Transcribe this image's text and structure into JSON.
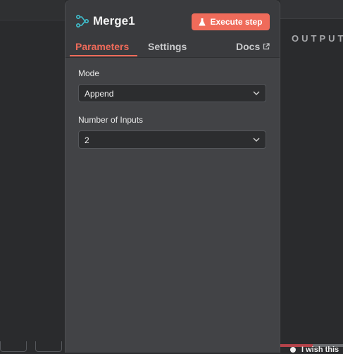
{
  "node": {
    "title": "Merge1",
    "execute_label": "Execute step"
  },
  "tabs": {
    "parameters": "Parameters",
    "settings": "Settings",
    "docs": "Docs"
  },
  "fields": {
    "mode_label": "Mode",
    "mode_value": "Append",
    "inputs_label": "Number of Inputs",
    "inputs_value": "2"
  },
  "output": {
    "label": "OUTPUT"
  },
  "footer": {
    "wish_text": "I wish this"
  },
  "colors": {
    "accent": "#ef6b5a",
    "node_icon": "#3fc1d0"
  },
  "icons": [
    "merge-node-icon",
    "flask-icon",
    "external-link-icon",
    "chevron-down-icon"
  ]
}
